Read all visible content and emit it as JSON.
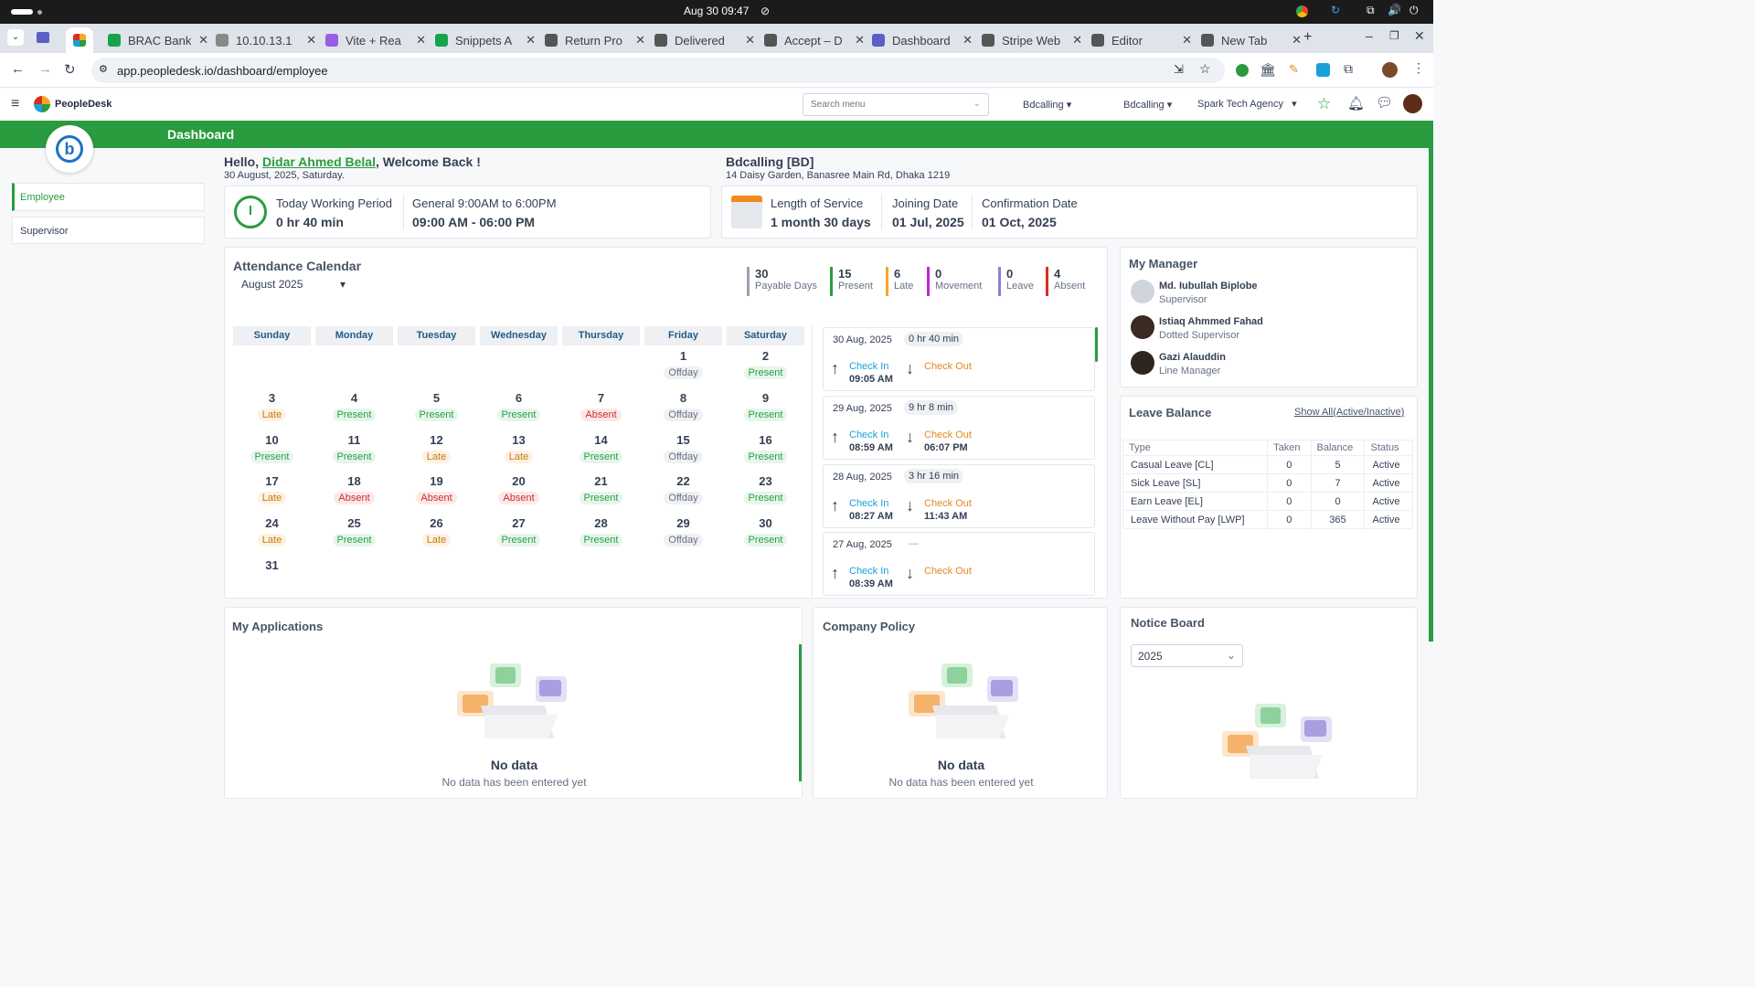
{
  "os": {
    "datetime": "Aug 30  09:47"
  },
  "browser": {
    "tabs": [
      {
        "title": "BRAC Bank"
      },
      {
        "title": "10.10.13.1"
      },
      {
        "title": "Vite + Rea"
      },
      {
        "title": "Snippets A"
      },
      {
        "title": "Return Pro"
      },
      {
        "title": "Delivered"
      },
      {
        "title": "Accept – D"
      },
      {
        "title": "Dashboard"
      },
      {
        "title": "Stripe Web"
      },
      {
        "title": "Editor"
      },
      {
        "title": "New Tab"
      }
    ],
    "url": "app.peopledesk.io/dashboard/employee"
  },
  "app": {
    "brand": "PeopleDesk",
    "search_placeholder": "Search menu",
    "org1": "Bdcalling",
    "org2": "Bdcalling",
    "org3": "Spark Tech Agency",
    "page_title": "Dashboard"
  },
  "sidebar": {
    "items": [
      {
        "label": "Employee"
      },
      {
        "label": "Supervisor"
      }
    ]
  },
  "welcome": {
    "hello": "Hello,",
    "name": "Didar Ahmed Belal",
    "suffix": ", Welcome Back !",
    "date": "30 August, 2025, Saturday."
  },
  "company": {
    "name": "Bdcalling [BD]",
    "address": "14 Daisy Garden, Banasree Main Rd, Dhaka 1219"
  },
  "work": {
    "period_label": "Today Working Period",
    "period_value": "0 hr 40 min",
    "shift_label": "General 9:00AM to 6:00PM",
    "shift_value": "09:00 AM - 06:00 PM"
  },
  "service": {
    "los_label": "Length of Service",
    "los_value": "1 month 30 days",
    "join_label": "Joining Date",
    "join_value": "01 Jul, 2025",
    "confirm_label": "Confirmation Date",
    "confirm_value": "01 Oct, 2025"
  },
  "attendance": {
    "title": "Attendance Calendar",
    "month": "August  2025",
    "stats": [
      {
        "value": "30",
        "label": "Payable Days",
        "color": "#98a2b3"
      },
      {
        "value": "15",
        "label": "Present",
        "color": "#2a9c3f"
      },
      {
        "value": "6",
        "label": "Late",
        "color": "#f5a623"
      },
      {
        "value": "0",
        "label": "Movement",
        "color": "#c026d3"
      },
      {
        "value": "0",
        "label": "Leave",
        "color": "#8b7fd6"
      },
      {
        "value": "4",
        "label": "Absent",
        "color": "#d92d20"
      }
    ],
    "weekdays": [
      "Sunday",
      "Monday",
      "Tuesday",
      "Wednesday",
      "Thursday",
      "Friday",
      "Saturday"
    ],
    "days": [
      {
        "n": "1",
        "s": "Offday"
      },
      {
        "n": "2",
        "s": "Present"
      },
      {
        "n": "3",
        "s": "Late"
      },
      {
        "n": "4",
        "s": "Present"
      },
      {
        "n": "5",
        "s": "Present"
      },
      {
        "n": "6",
        "s": "Present"
      },
      {
        "n": "7",
        "s": "Absent"
      },
      {
        "n": "8",
        "s": "Offday"
      },
      {
        "n": "9",
        "s": "Present"
      },
      {
        "n": "10",
        "s": "Present"
      },
      {
        "n": "11",
        "s": "Present"
      },
      {
        "n": "12",
        "s": "Late"
      },
      {
        "n": "13",
        "s": "Late"
      },
      {
        "n": "14",
        "s": "Present"
      },
      {
        "n": "15",
        "s": "Offday"
      },
      {
        "n": "16",
        "s": "Present"
      },
      {
        "n": "17",
        "s": "Late"
      },
      {
        "n": "18",
        "s": "Absent"
      },
      {
        "n": "19",
        "s": "Absent"
      },
      {
        "n": "20",
        "s": "Absent"
      },
      {
        "n": "21",
        "s": "Present"
      },
      {
        "n": "22",
        "s": "Offday"
      },
      {
        "n": "23",
        "s": "Present"
      },
      {
        "n": "24",
        "s": "Late"
      },
      {
        "n": "25",
        "s": "Present"
      },
      {
        "n": "26",
        "s": "Late"
      },
      {
        "n": "27",
        "s": "Present"
      },
      {
        "n": "28",
        "s": "Present"
      },
      {
        "n": "29",
        "s": "Offday"
      },
      {
        "n": "30",
        "s": "Present"
      },
      {
        "n": "31",
        "s": ""
      }
    ],
    "log": [
      {
        "date": "30 Aug, 2025",
        "duration": "0 hr 40 min",
        "in_label": "Check In",
        "in_time": "09:05 AM",
        "out_label": "Check Out",
        "out_time": ""
      },
      {
        "date": "29 Aug, 2025",
        "duration": "9 hr 8 min",
        "in_label": "Check In",
        "in_time": "08:59 AM",
        "out_label": "Check Out",
        "out_time": "06:07 PM"
      },
      {
        "date": "28 Aug, 2025",
        "duration": "3 hr 16 min",
        "in_label": "Check In",
        "in_time": "08:27 AM",
        "out_label": "Check Out",
        "out_time": "11:43 AM"
      },
      {
        "date": "27 Aug, 2025",
        "duration": "—",
        "in_label": "Check In",
        "in_time": "08:39 AM",
        "out_label": "Check Out",
        "out_time": ""
      }
    ]
  },
  "manager": {
    "title": "My Manager",
    "people": [
      {
        "name": "Md. Iubullah Biplobe",
        "role": "Supervisor"
      },
      {
        "name": "Istiaq Ahmmed Fahad",
        "role": "Dotted Supervisor"
      },
      {
        "name": "Gazi Alauddin",
        "role": "Line Manager"
      }
    ]
  },
  "leave": {
    "title": "Leave Balance",
    "show_all": "Show All(Active/Inactive)",
    "headers": [
      "Type",
      "Taken",
      "Balance",
      "Status"
    ],
    "rows": [
      [
        "Casual Leave [CL]",
        "0",
        "5",
        "Active"
      ],
      [
        "Sick Leave [SL]",
        "0",
        "7",
        "Active"
      ],
      [
        "Earn Leave [EL]",
        "0",
        "0",
        "Active"
      ],
      [
        "Leave Without Pay [LWP]",
        "0",
        "365",
        "Active"
      ]
    ]
  },
  "applications": {
    "title": "My Applications",
    "empty_title": "No data",
    "empty_sub": "No data has been entered yet"
  },
  "policy": {
    "title": "Company Policy",
    "empty_title": "No data",
    "empty_sub": "No data has been entered yet"
  },
  "notice": {
    "title": "Notice Board",
    "year": "2025"
  }
}
